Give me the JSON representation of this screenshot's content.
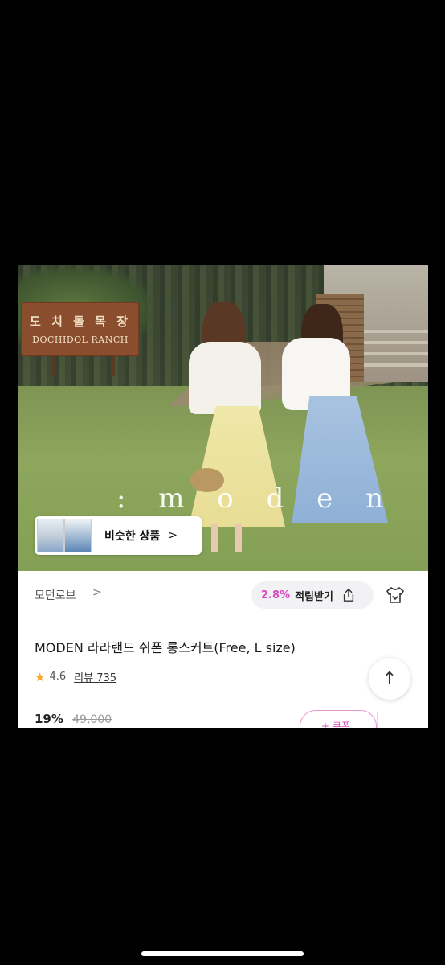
{
  "product_image": {
    "sign_korean": "도 치 돌 목 장",
    "sign_english": "DOCHIDOL RANCH",
    "watermark": ": m o d e n"
  },
  "similar": {
    "label": "비슷한 상품",
    "chevron": ">"
  },
  "brand": {
    "name": "모던로브",
    "chevron": ">"
  },
  "points": {
    "percent": "2.8%",
    "label": "적립받기",
    "share_icon": "share-icon"
  },
  "product": {
    "title": "MODEN 라라랜드 쉬폰 롱스커트(Free, L size)",
    "rating": "4.6",
    "reviews": "리뷰 735",
    "discount": "19%",
    "original_price": "49,000",
    "coupon_partial": "+ 쿠폰"
  },
  "scroll_top": {
    "arrow": "↑"
  },
  "colors": {
    "accent": "#d64bbd",
    "star": "#f5a623",
    "background": "#000000"
  }
}
